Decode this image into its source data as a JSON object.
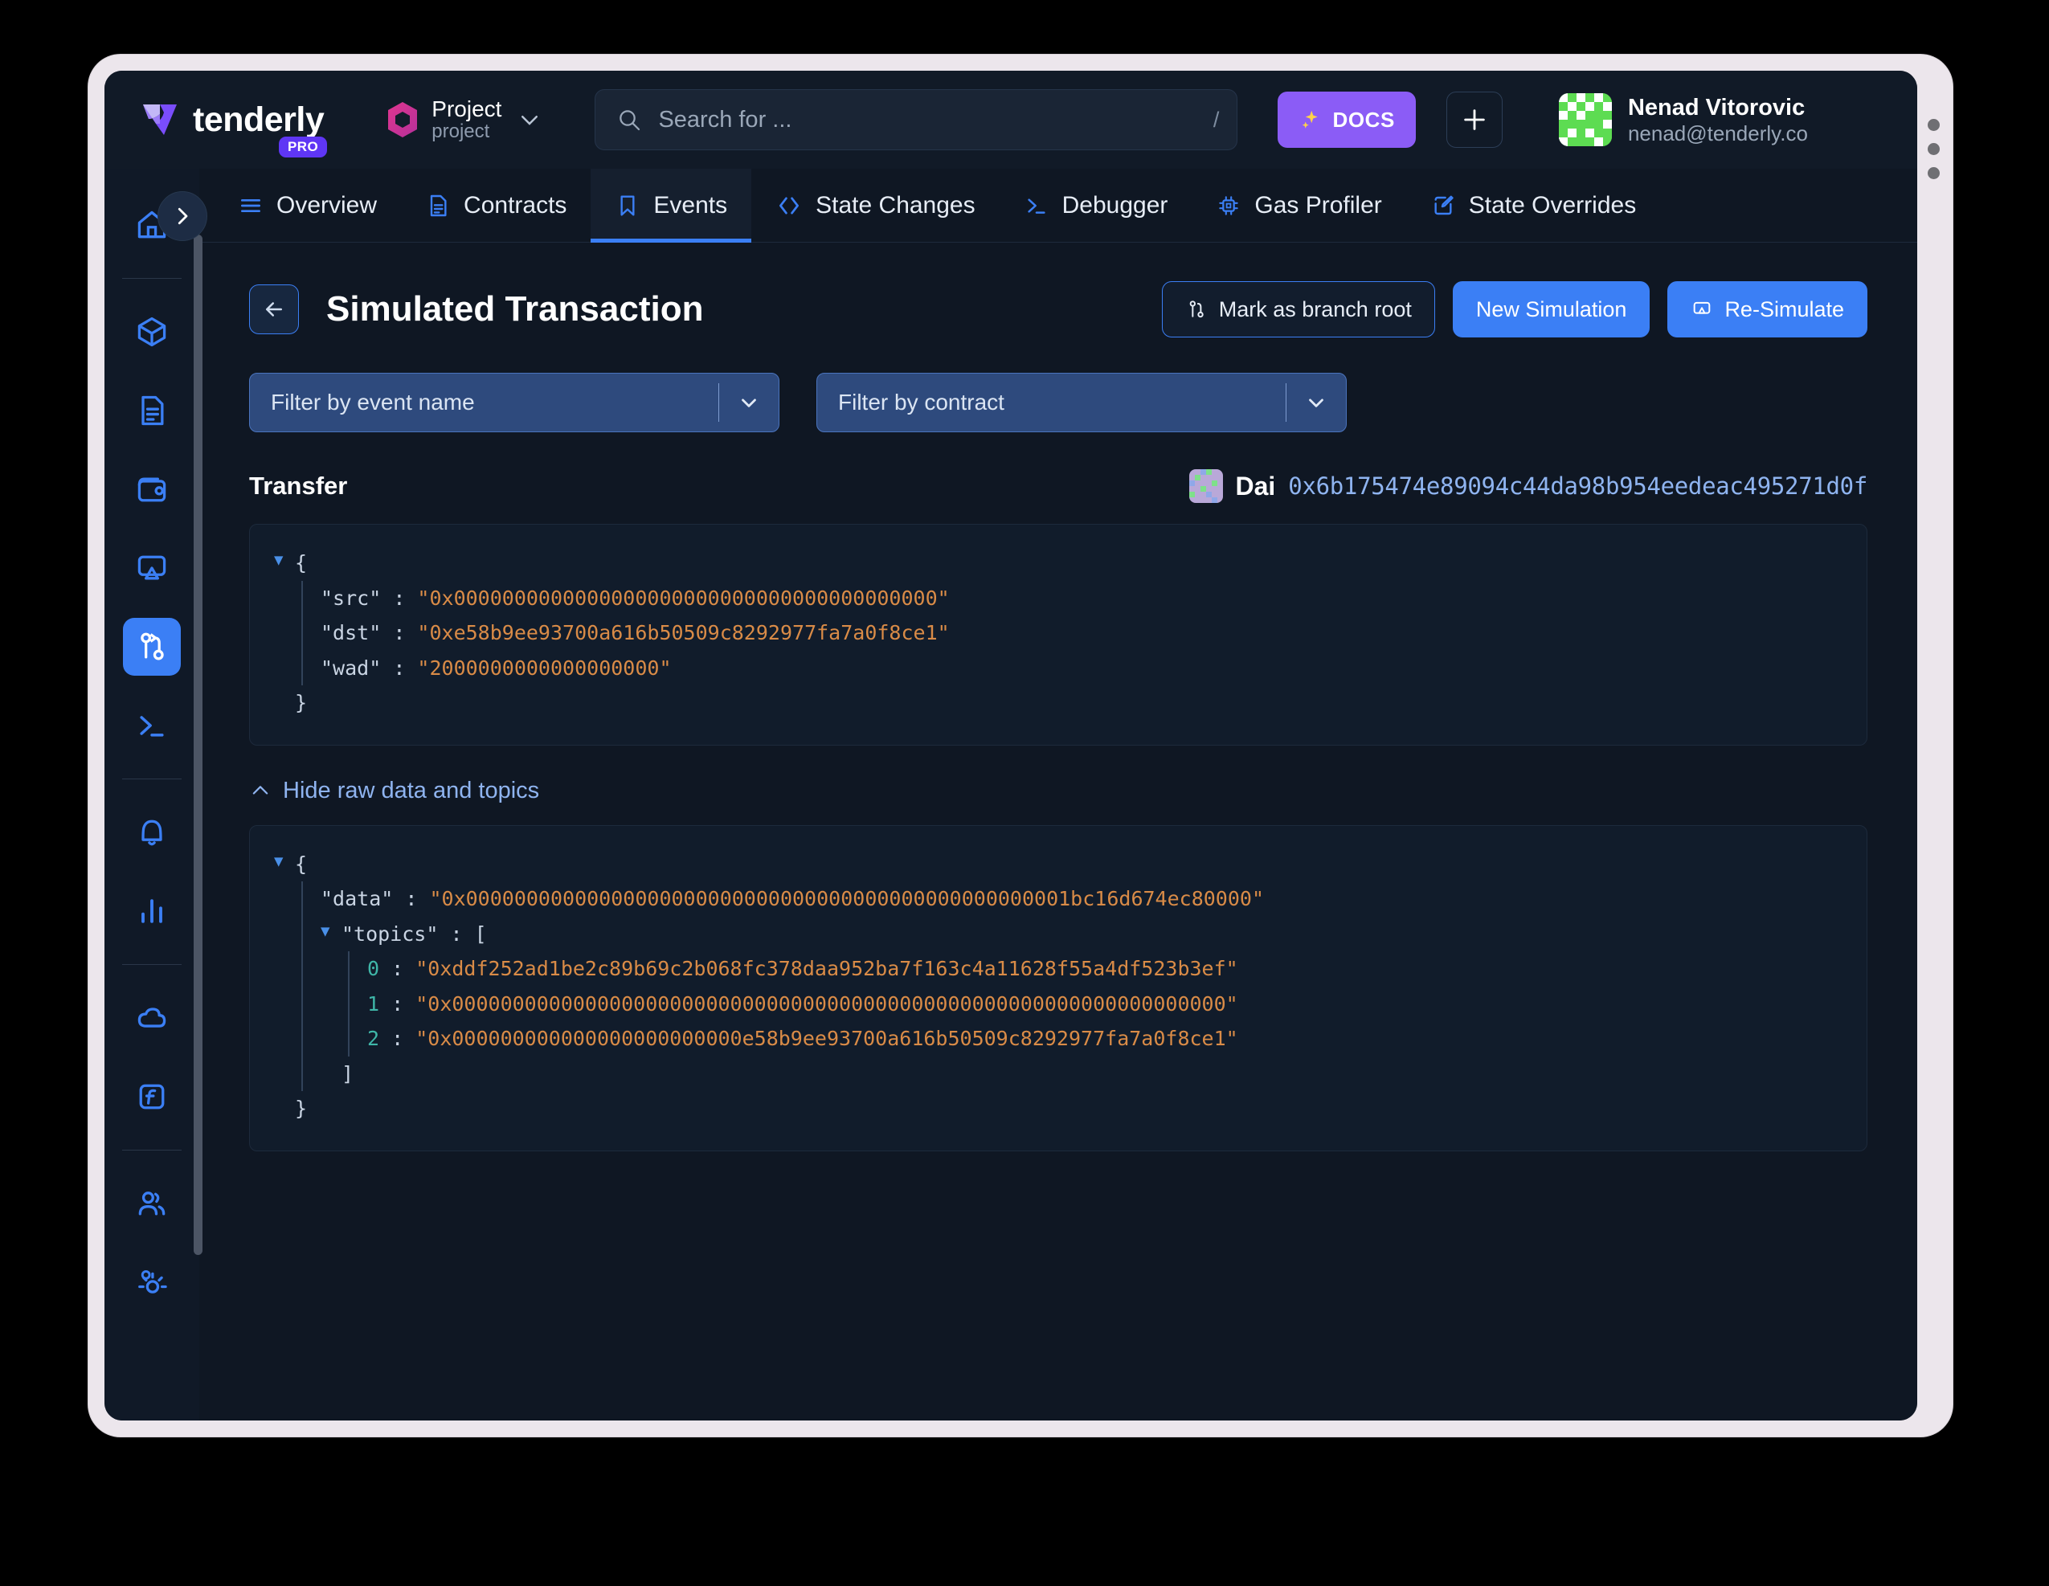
{
  "app": {
    "brand": "tenderly",
    "plan_badge": "PRO"
  },
  "project_switcher": {
    "name": "Project",
    "slug": "project",
    "chevron_icon": "chevron-down-icon",
    "hex_icon": "project-hexagon-icon"
  },
  "search": {
    "placeholder": "Search for ...",
    "shortcut": "/",
    "icon": "search-icon"
  },
  "header": {
    "docs_label": "DOCS",
    "docs_icon": "sparkles-icon",
    "plus_icon": "plus-icon",
    "user_name": "Nenad Vitorovic",
    "user_email": "nenad@tenderly.co",
    "avatar_icon": "avatar"
  },
  "sidebar": {
    "collapse_icon": "chevron-right-icon",
    "items": [
      {
        "name": "home",
        "icon": "home-icon",
        "active": false
      },
      {
        "name": "contracts",
        "icon": "cube-icon",
        "active": false
      },
      {
        "name": "transactions",
        "icon": "document-icon",
        "active": false
      },
      {
        "name": "wallets",
        "icon": "wallet-icon",
        "active": false
      },
      {
        "name": "monitoring",
        "icon": "screen-icon",
        "active": false
      },
      {
        "name": "simulator",
        "icon": "branch-icon",
        "active": true
      },
      {
        "name": "devnets",
        "icon": "terminal-icon",
        "active": false
      },
      {
        "name": "alerts",
        "icon": "bell-icon",
        "active": false
      },
      {
        "name": "analytics",
        "icon": "bar-chart-icon",
        "active": false
      },
      {
        "name": "web3-gateway",
        "icon": "cloud-icon",
        "active": false
      },
      {
        "name": "actions",
        "icon": "function-icon",
        "active": false
      },
      {
        "name": "collaborators",
        "icon": "people-icon",
        "active": false
      },
      {
        "name": "settings",
        "icon": "gears-icon",
        "active": false
      }
    ]
  },
  "tabs": [
    {
      "label": "Overview",
      "icon": "list-icon",
      "active": false
    },
    {
      "label": "Contracts",
      "icon": "document-icon",
      "active": false
    },
    {
      "label": "Events",
      "icon": "bookmark-icon",
      "active": true
    },
    {
      "label": "State Changes",
      "icon": "code-brackets-icon",
      "active": false
    },
    {
      "label": "Debugger",
      "icon": "terminal-icon",
      "active": false
    },
    {
      "label": "Gas Profiler",
      "icon": "chip-icon",
      "active": false
    },
    {
      "label": "State Overrides",
      "icon": "edit-pencil-icon",
      "active": false
    }
  ],
  "page": {
    "title": "Simulated Transaction",
    "back_icon": "arrow-left-icon",
    "actions": [
      {
        "label": "Mark as branch root",
        "icon": "branch-icon",
        "style": "ghost"
      },
      {
        "label": "New Simulation",
        "icon": "",
        "style": "primary"
      },
      {
        "label": "Re-Simulate",
        "icon": "screen-refresh-icon",
        "style": "primary"
      }
    ]
  },
  "filters": [
    {
      "label": "Filter by event name",
      "chevron_icon": "chevron-down-icon"
    },
    {
      "label": "Filter by contract",
      "chevron_icon": "chevron-down-icon"
    }
  ],
  "event": {
    "name": "Transfer",
    "contract_name": "Dai",
    "contract_address": "0x6b175474e89094c44da98b954eedeac495271d0f",
    "contract_icon": "contract-avatar"
  },
  "decoded_json": {
    "open_brace": "{",
    "close_brace": "}",
    "rows": [
      {
        "key": "\"src\"",
        "colon": " : ",
        "value": "\"0x0000000000000000000000000000000000000000\""
      },
      {
        "key": "\"dst\"",
        "colon": " : ",
        "value": "\"0xe58b9ee93700a616b50509c8292977fa7a0f8ce1\""
      },
      {
        "key": "\"wad\"",
        "colon": " : ",
        "value": "\"2000000000000000000\""
      }
    ]
  },
  "raw_toggle": {
    "label": "Hide raw data and topics",
    "icon": "chevron-up-icon"
  },
  "raw_json": {
    "open_brace": "{",
    "close_brace": "}",
    "data_key": "\"data\"",
    "data_colon": " : ",
    "data_value": "\"0x00000000000000000000000000000000000000000000000001bc16d674ec80000\"",
    "topics_key": "\"topics\"",
    "topics_colon": " : ",
    "topics_open": "[",
    "topics_close": "]",
    "topics": [
      {
        "index": "0",
        "colon": " : ",
        "value": "\"0xddf252ad1be2c89b69c2b068fc378daa952ba7f163c4a11628f55a4df523b3ef\""
      },
      {
        "index": "1",
        "colon": " : ",
        "value": "\"0x0000000000000000000000000000000000000000000000000000000000000000\""
      },
      {
        "index": "2",
        "colon": " : ",
        "value": "\"0x000000000000000000000000e58b9ee93700a616b50509c8292977fa7a0f8ce1\""
      }
    ]
  },
  "colors": {
    "accent_blue": "#3b7ff5",
    "accent_purple": "#8b5cf6",
    "page_bg": "#0f1723",
    "panel_bg": "#111c2b",
    "string_orange": "#d98b47",
    "index_teal": "#3fb6a8",
    "link_blue": "#8fb4f0"
  }
}
